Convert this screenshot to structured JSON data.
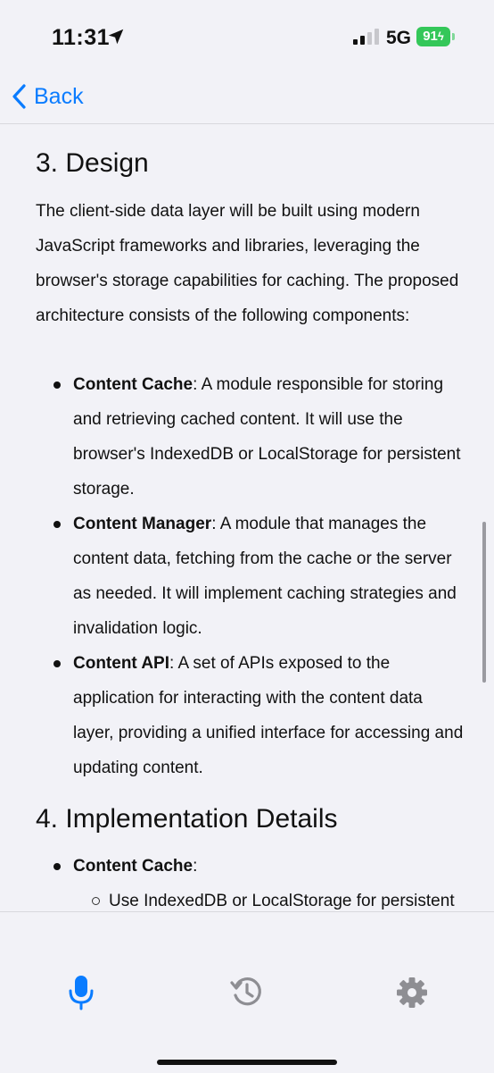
{
  "status_bar": {
    "time": "11:31",
    "network": "5G",
    "battery": "91"
  },
  "nav": {
    "back_label": "Back"
  },
  "document": {
    "section3_heading": "3. Design",
    "section3_intro": "The client-side data layer will be built using modern JavaScript frameworks and libraries, leveraging the browser's storage capabilities for caching. The proposed architecture consists of the following components:",
    "components": [
      {
        "term": "Content Cache",
        "desc": ": A module responsible for storing and retrieving cached content. It will use the browser's IndexedDB or LocalStorage for persistent storage."
      },
      {
        "term": "Content Manager",
        "desc": ": A module that manages the content data, fetching from the cache or the server as needed. It will implement caching strategies and invalidation logic."
      },
      {
        "term": "Content API",
        "desc": ": A set of APIs exposed to the application for interacting with the content data layer, providing a unified interface for accessing and updating content."
      }
    ],
    "section4_heading": "4. Implementation Details",
    "impl_items": [
      {
        "term": "Content Cache",
        "desc": ":",
        "sub_items": [
          "Use IndexedDB or LocalStorage for persistent client-side storage."
        ]
      }
    ]
  },
  "toolbar": {
    "icons": [
      "microphone-icon",
      "history-icon",
      "gear-icon"
    ]
  },
  "colors": {
    "accent": "#0a7cff",
    "battery": "#34c759",
    "background": "#f2f2f7",
    "icon_gray": "#8e8e93"
  }
}
